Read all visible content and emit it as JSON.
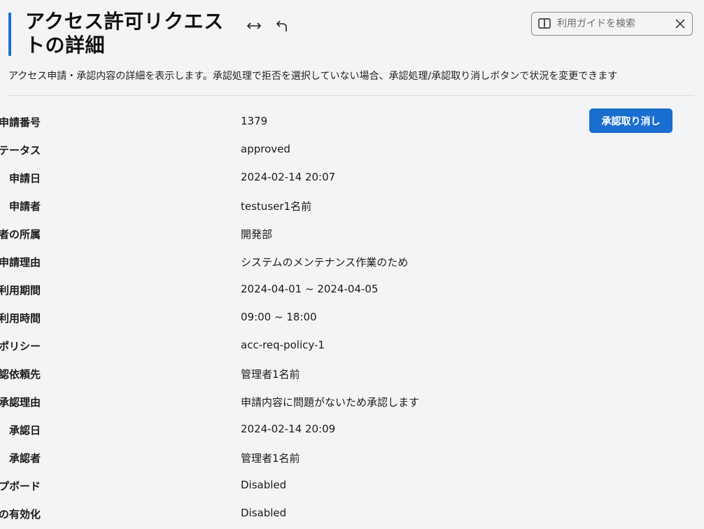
{
  "header": {
    "title": "アクセス許可リクエストの詳細",
    "expand_icon": "expand-horizontal-icon",
    "back_icon": "undo-arrow-icon"
  },
  "search": {
    "placeholder": "利用ガイドを検索",
    "value": "",
    "guide_icon": "book-icon",
    "clear_icon": "close-icon"
  },
  "description": "アクセス申請・承認内容の詳細を表示します。承認処理で拒否を選択していない場合、承認処理/承認取り消しボタンで状況を変更できます",
  "actions": {
    "revoke_label": "承認取り消し"
  },
  "colors": {
    "accent": "#1f6fd1",
    "button": "#1a6ecf",
    "background": "#f3f4f6"
  },
  "details": [
    {
      "label": "申請番号",
      "value": "1379"
    },
    {
      "label": "ステータス",
      "value": "approved"
    },
    {
      "label": "申請日",
      "value": "2024-02-14 20:07"
    },
    {
      "label": "申請者",
      "value": "testuser1名前"
    },
    {
      "label": "申請者の所属",
      "value": "開発部"
    },
    {
      "label": "申請理由",
      "value": "システムのメンテナンス作業のため"
    },
    {
      "label": "利用期間",
      "value": "2024-04-01 ~ 2024-04-05"
    },
    {
      "label": "利用時間",
      "value": "09:00 ~ 18:00"
    },
    {
      "label": "アクセス申請ポリシー",
      "value": "acc-req-policy-1"
    },
    {
      "label": "承認依頼先",
      "value": "管理者1名前"
    },
    {
      "label": "承認理由",
      "value": "申請内容に問題がないため承認します"
    },
    {
      "label": "承認日",
      "value": "2024-02-14 20:09"
    },
    {
      "label": "承認者",
      "value": "管理者1名前"
    },
    {
      "label": "クリップボード",
      "value": "Disabled"
    },
    {
      "label": "操作録画の有効化",
      "value": "Disabled"
    }
  ]
}
